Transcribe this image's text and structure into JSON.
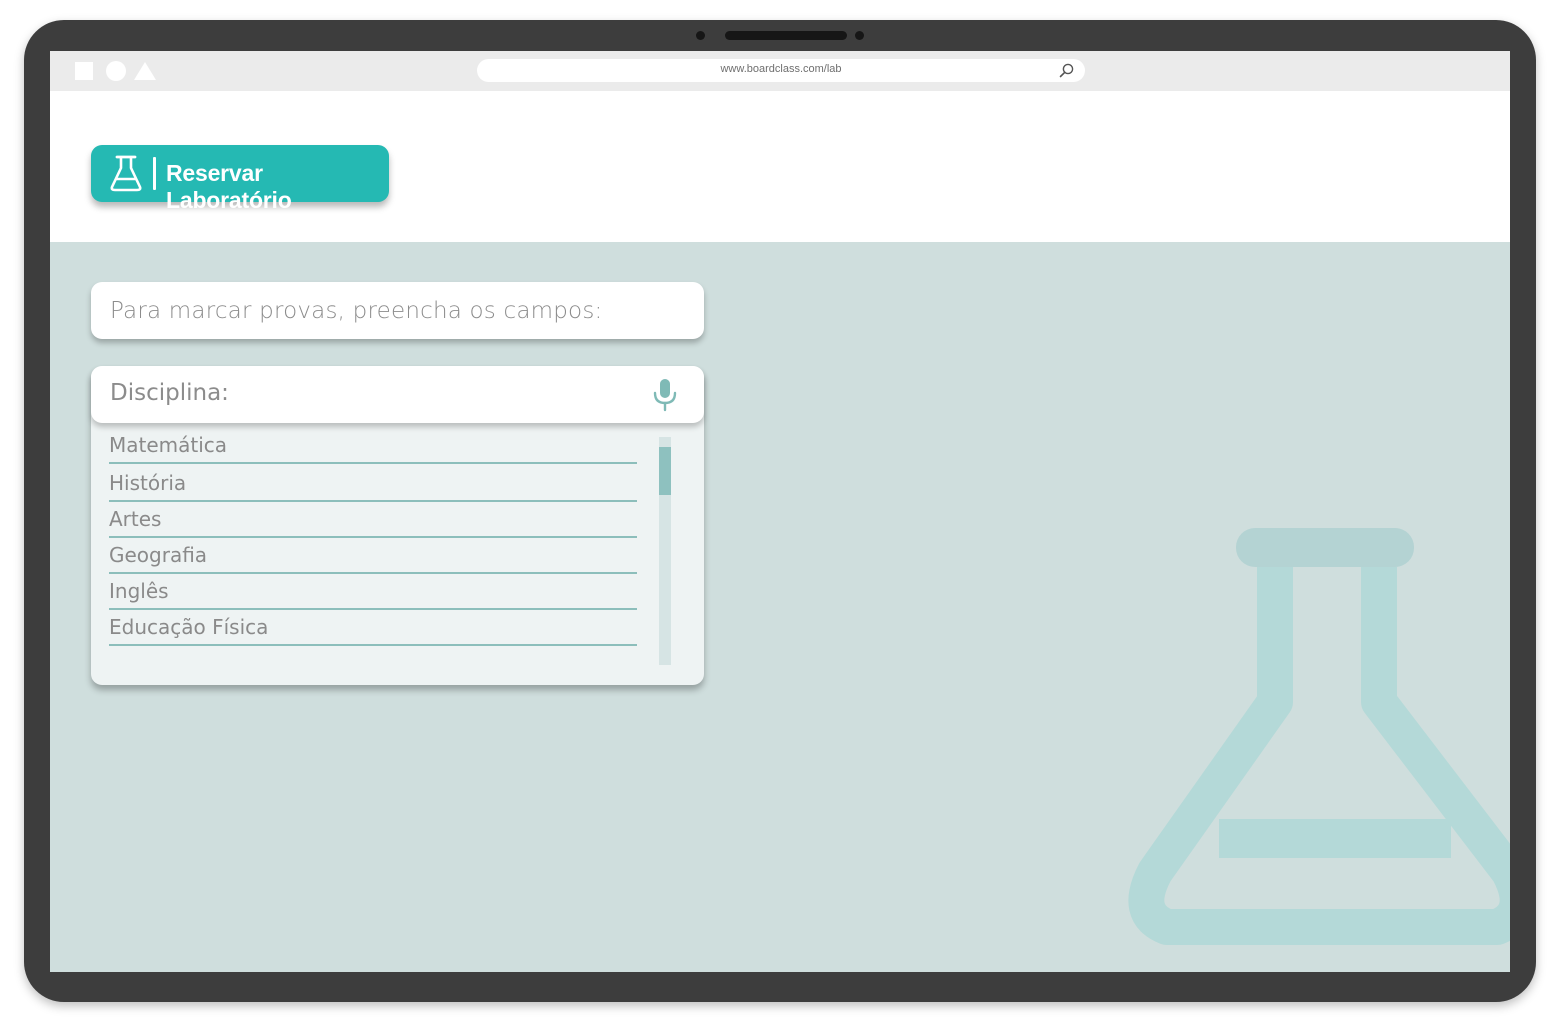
{
  "browser": {
    "url": "www.boardclass.com/lab"
  },
  "header": {
    "reserve_button_label": "Reservar Laboratório"
  },
  "form": {
    "instruction": "Para marcar provas, preencha os campos:",
    "discipline_label": "Disciplina:",
    "options": [
      {
        "label": "Matemática"
      },
      {
        "label": "História"
      },
      {
        "label": "Artes"
      },
      {
        "label": "Geografia"
      },
      {
        "label": "Inglês"
      },
      {
        "label": "Educação Física"
      }
    ]
  },
  "icons": {
    "flask": "flask-icon",
    "microphone": "microphone-icon",
    "search": "search-icon"
  },
  "colors": {
    "accent": "#25b9b3",
    "background": "#cfdedd",
    "option_divider": "#8cbebb",
    "device_frame": "#3d3d3d"
  }
}
